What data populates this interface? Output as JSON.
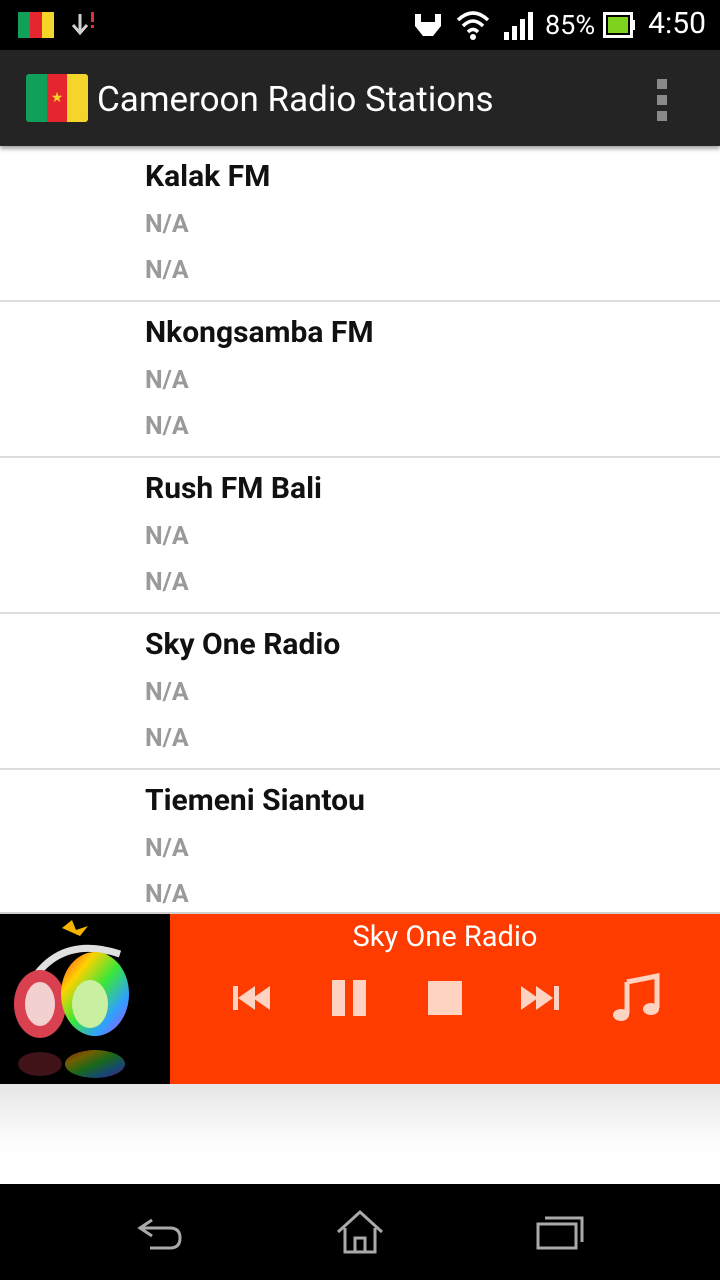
{
  "status_bar": {
    "time": "4:50",
    "battery_percent": "85%",
    "icons": [
      "cameroon-flag-notification-icon",
      "download-icon",
      "usb-icon",
      "wifi-icon",
      "signal-icon",
      "battery-icon"
    ]
  },
  "action_bar": {
    "title": "Cameroon Radio Stations",
    "menu_icon": "overflow-menu-icon"
  },
  "stations": [
    {
      "name": "Kalak FM",
      "line1": "N/A",
      "line2": "N/A"
    },
    {
      "name": "Nkongsamba FM",
      "line1": "N/A",
      "line2": "N/A"
    },
    {
      "name": "Rush FM Bali",
      "line1": "N/A",
      "line2": "N/A"
    },
    {
      "name": "Sky One Radio",
      "line1": "N/A",
      "line2": "N/A"
    },
    {
      "name": "Tiemeni Siantou",
      "line1": "N/A",
      "line2": "N/A"
    }
  ],
  "player": {
    "now_playing": "Sky One Radio",
    "controls": [
      "previous-icon",
      "pause-icon",
      "stop-icon",
      "next-icon",
      "music-note-icon"
    ]
  },
  "nav_bar": {
    "buttons": [
      "back-icon",
      "home-icon",
      "recent-apps-icon"
    ]
  },
  "colors": {
    "player_accent": "#ff3c00",
    "action_bar": "#242424"
  }
}
